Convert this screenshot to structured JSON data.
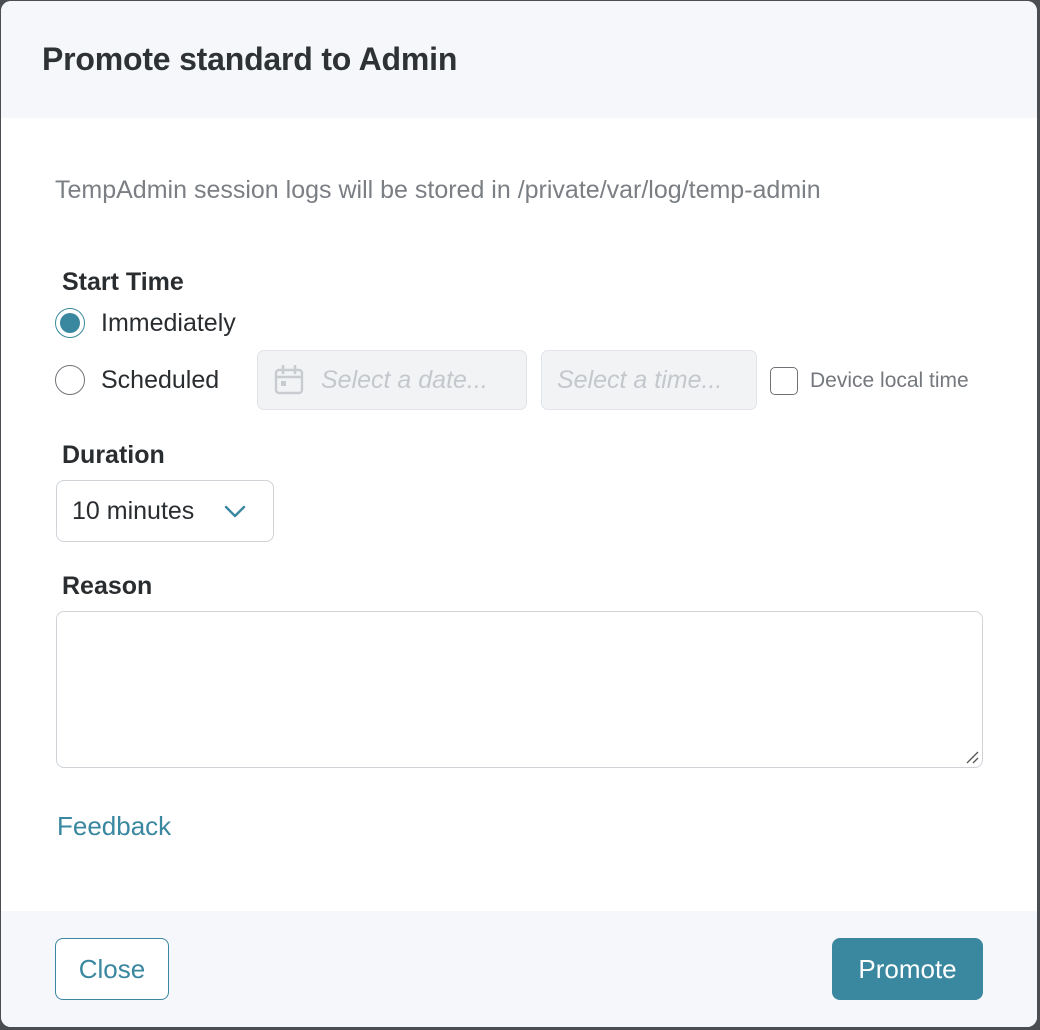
{
  "dialog": {
    "title": "Promote standard to Admin",
    "info_text": "TempAdmin session logs will be stored in /private/var/log/temp-admin"
  },
  "start_time": {
    "label": "Start Time",
    "options": [
      {
        "label": "Immediately",
        "selected": true
      },
      {
        "label": "Scheduled",
        "selected": false
      }
    ],
    "date_placeholder": "Select a date...",
    "time_placeholder": "Select a time...",
    "device_local_time_label": "Device local time",
    "device_local_time_checked": false
  },
  "duration": {
    "label": "Duration",
    "selected": "10 minutes"
  },
  "reason": {
    "label": "Reason",
    "value": ""
  },
  "feedback_link": "Feedback",
  "footer": {
    "close_label": "Close",
    "promote_label": "Promote"
  },
  "colors": {
    "accent": "#3a87a0",
    "header_bg": "#f5f7fa",
    "muted_text": "#7b7f84"
  },
  "icons": {
    "date": "calendar-icon",
    "dropdown": "chevron-down-icon",
    "textarea": "resize-handle-icon"
  }
}
